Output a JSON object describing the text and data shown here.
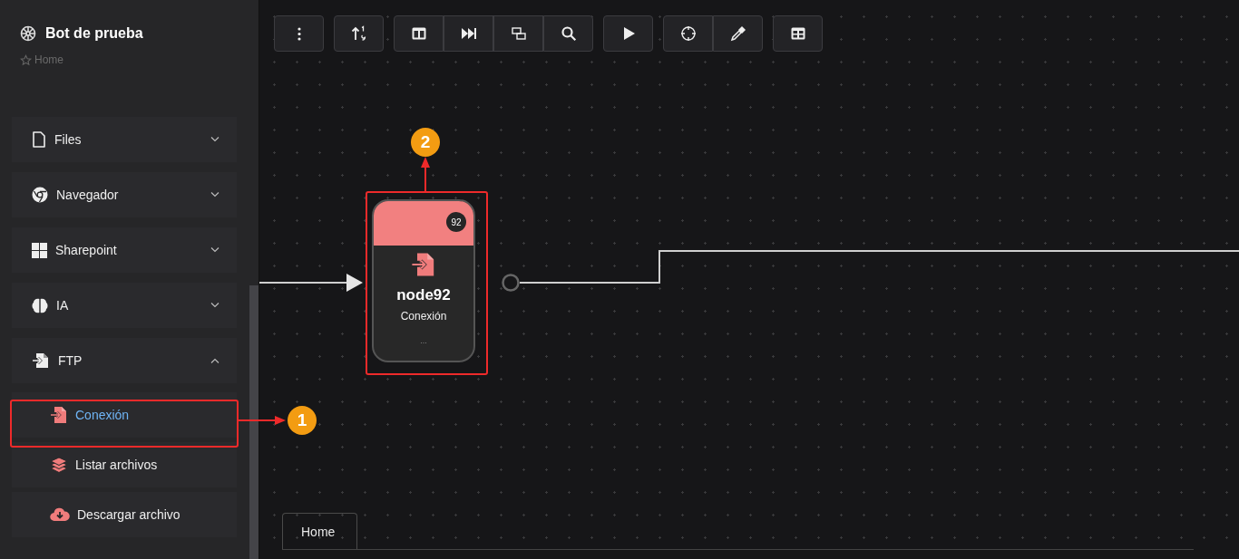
{
  "sidebar": {
    "title": "Bot de prueba",
    "breadcrumb": "Home",
    "groups": [
      {
        "label": "Files",
        "expanded": false
      },
      {
        "label": "Navegador",
        "expanded": false
      },
      {
        "label": "Sharepoint",
        "expanded": false
      },
      {
        "label": "IA",
        "expanded": false
      },
      {
        "label": "FTP",
        "expanded": true,
        "children": [
          {
            "label": "Conexión",
            "selected": true
          },
          {
            "label": "Listar archivos",
            "selected": false
          },
          {
            "label": "Descargar archivo",
            "selected": false
          }
        ]
      }
    ]
  },
  "canvas": {
    "node": {
      "title": "node92",
      "subtitle": "Conexión",
      "badge": "92",
      "more": "..."
    },
    "tabs": [
      {
        "label": "Home",
        "selected": true
      }
    ]
  },
  "annotations": [
    {
      "number": "1"
    },
    {
      "number": "2"
    }
  ]
}
